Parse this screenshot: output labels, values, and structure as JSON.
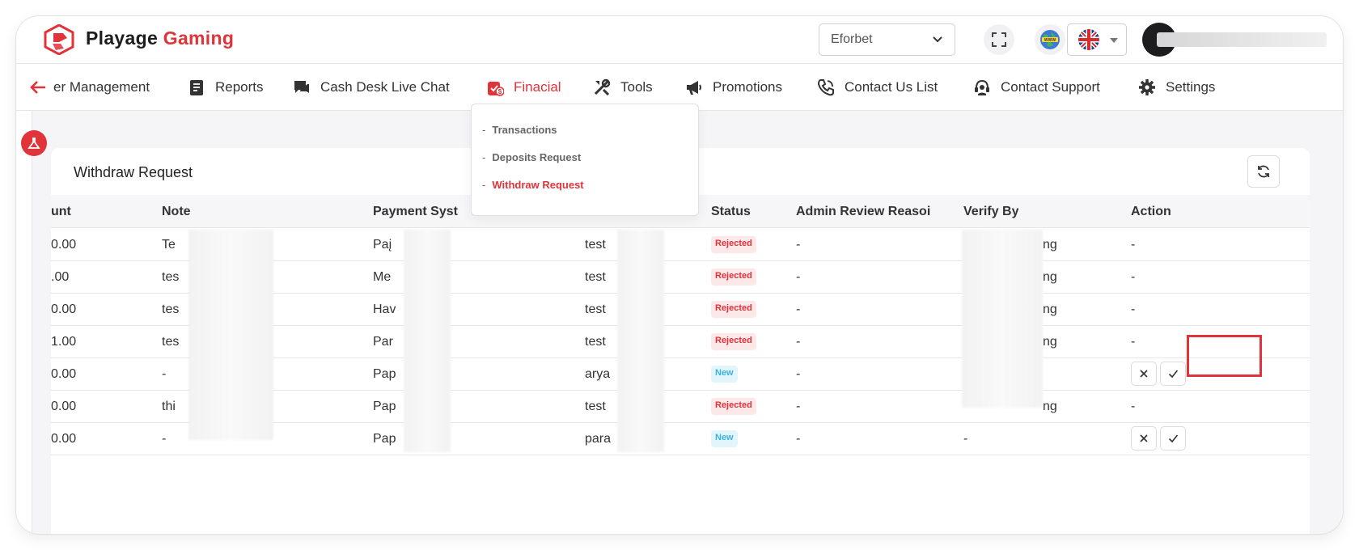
{
  "header": {
    "logo_primary": "Playage",
    "logo_accent": "Gaming",
    "brand_select_value": "Eforbet",
    "colors": {
      "accent": "#e0333a",
      "new_badge": "#3bb3db"
    }
  },
  "nav": {
    "items": [
      {
        "label": "er Management",
        "icon": "users-icon"
      },
      {
        "label": "Reports",
        "icon": "report-icon"
      },
      {
        "label": "Cash Desk Live Chat",
        "icon": "chat-icon"
      },
      {
        "label": "Finacial",
        "icon": "finance-icon",
        "active": true
      },
      {
        "label": "Tools",
        "icon": "tools-icon"
      },
      {
        "label": "Promotions",
        "icon": "megaphone-icon"
      },
      {
        "label": "Contact Us List",
        "icon": "phone-icon"
      },
      {
        "label": "Contact Support",
        "icon": "headset-icon"
      },
      {
        "label": "Settings",
        "icon": "gear-icon"
      }
    ]
  },
  "dropdown": {
    "items": [
      {
        "label": "Transactions"
      },
      {
        "label": "Deposits Request"
      },
      {
        "label": "Withdraw Request",
        "active": true
      }
    ]
  },
  "card": {
    "title": "Withdraw Request"
  },
  "table": {
    "columns": [
      "unt",
      "Note",
      "Payment Syst",
      "Status",
      "Admin Review Reasoi",
      "Verify By",
      "Action"
    ],
    "rows": [
      {
        "amount": "0.00",
        "note": "Te",
        "payment": "Paį",
        "user": "test",
        "status": "Rejected",
        "reason": "-",
        "verify": "ng",
        "action": "-"
      },
      {
        "amount": ".00",
        "note": "tes",
        "payment": "Me",
        "user": "test",
        "status": "Rejected",
        "reason": "-",
        "verify": "ng",
        "action": "-"
      },
      {
        "amount": "0.00",
        "note": "tes",
        "payment": "Hav",
        "user": "test",
        "status": "Rejected",
        "reason": "-",
        "verify": "ng",
        "action": "-"
      },
      {
        "amount": "1.00",
        "note": "tes",
        "payment": "Par",
        "user": "test",
        "status": "Rejected",
        "reason": "-",
        "verify": "ng",
        "action": "-"
      },
      {
        "amount": "0.00",
        "note": "-",
        "payment": "Pap",
        "user": "arya",
        "status": "New",
        "reason": "-",
        "verify": "",
        "action": "buttons"
      },
      {
        "amount": "0.00",
        "note": "thi",
        "payment": "Pap",
        "user": "test",
        "status": "Rejected",
        "reason": "-",
        "verify": "ng",
        "action": "-"
      },
      {
        "amount": "0.00",
        "note": "-",
        "payment": "Pap",
        "user": "para",
        "status": "New",
        "reason": "-",
        "verify": "-",
        "action": "buttons"
      }
    ]
  }
}
